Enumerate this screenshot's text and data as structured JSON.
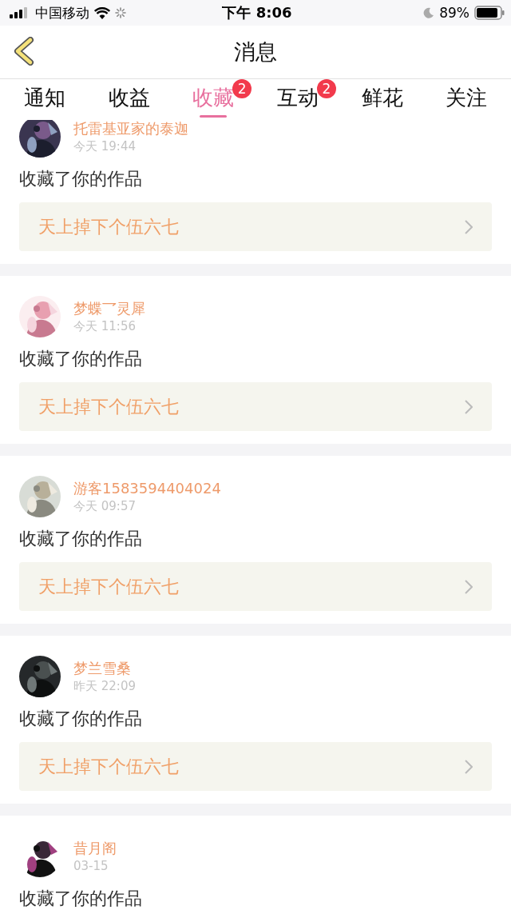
{
  "status_bar": {
    "carrier": "中国移动",
    "time": "下午 8:06",
    "battery": "89%"
  },
  "nav": {
    "title": "消息"
  },
  "tabs": [
    {
      "label": "通知",
      "selected": false
    },
    {
      "label": "收益",
      "selected": false
    },
    {
      "label": "收藏",
      "selected": true,
      "badge": "2"
    },
    {
      "label": "互动",
      "selected": false,
      "badge": "2"
    },
    {
      "label": "鲜花",
      "selected": false
    },
    {
      "label": "关注",
      "selected": false
    }
  ],
  "messages": [
    {
      "user": "托雷基亚家的泰迦",
      "time": "今天 19:44",
      "text": "收藏了你的作品",
      "work": "天上掉下个伍六七"
    },
    {
      "user": "梦蝶乛灵犀",
      "time": "今天 11:56",
      "text": "收藏了你的作品",
      "work": "天上掉下个伍六七"
    },
    {
      "user": "游客1583594404024",
      "time": "今天 09:57",
      "text": "收藏了你的作品",
      "work": "天上掉下个伍六七"
    },
    {
      "user": "梦兰雪桑",
      "time": "昨天 22:09",
      "text": "收藏了你的作品",
      "work": "天上掉下个伍六七"
    },
    {
      "user": "昔月阁",
      "time": "03-15",
      "text": "收藏了你的作品"
    }
  ]
}
